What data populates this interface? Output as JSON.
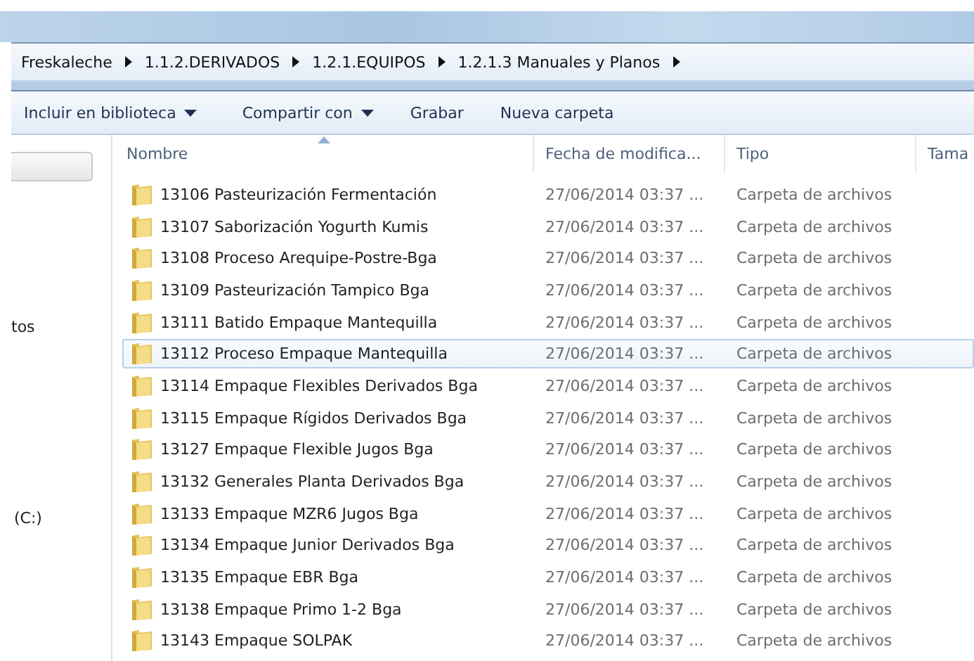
{
  "address_bar": {
    "crumbs": [
      "Freskaleche",
      "1.1.2.DERIVADOS",
      "1.2.1.EQUIPOS",
      "1.2.1.3 Manuales y Planos"
    ]
  },
  "toolbar": {
    "buttons": [
      {
        "label": "Incluir en biblioteca",
        "kind": "dropdown"
      },
      {
        "label": "Compartir con",
        "kind": "dropdown"
      },
      {
        "label": "Grabar",
        "kind": "plain"
      },
      {
        "label": "Nueva carpeta",
        "kind": "plain"
      }
    ]
  },
  "navigation_pane": {
    "items": [
      "tos",
      "(C:)"
    ]
  },
  "table": {
    "columns": [
      {
        "label": "Nombre",
        "sorted": true
      },
      {
        "label": "Fecha de modifica...",
        "sorted": false
      },
      {
        "label": "Tipo",
        "sorted": false
      },
      {
        "label": "Tama",
        "sorted": false
      }
    ],
    "rows": [
      {
        "name": "13106 Pasteurización Fermentación",
        "date": "27/06/2014 03:37 ...",
        "type": "Carpeta de archivos",
        "selected": false
      },
      {
        "name": "13107 Saborización Yogurth Kumis",
        "date": "27/06/2014 03:37 ...",
        "type": "Carpeta de archivos",
        "selected": false
      },
      {
        "name": "13108 Proceso Arequipe-Postre-Bga",
        "date": "27/06/2014 03:37 ...",
        "type": "Carpeta de archivos",
        "selected": false
      },
      {
        "name": "13109 Pasteurización Tampico Bga",
        "date": "27/06/2014 03:37 ...",
        "type": "Carpeta de archivos",
        "selected": false
      },
      {
        "name": "13111 Batido Empaque Mantequilla",
        "date": "27/06/2014 03:37 ...",
        "type": "Carpeta de archivos",
        "selected": false
      },
      {
        "name": "13112 Proceso Empaque Mantequilla",
        "date": "27/06/2014 03:37 ...",
        "type": "Carpeta de archivos",
        "selected": true
      },
      {
        "name": "13114 Empaque Flexibles Derivados Bga",
        "date": "27/06/2014 03:37 ...",
        "type": "Carpeta de archivos",
        "selected": false
      },
      {
        "name": "13115 Empaque Rígidos Derivados Bga",
        "date": "27/06/2014 03:37 ...",
        "type": "Carpeta de archivos",
        "selected": false
      },
      {
        "name": "13127 Empaque Flexible Jugos Bga",
        "date": "27/06/2014 03:37 ...",
        "type": "Carpeta de archivos",
        "selected": false
      },
      {
        "name": "13132 Generales Planta Derivados Bga",
        "date": "27/06/2014 03:37 ...",
        "type": "Carpeta de archivos",
        "selected": false
      },
      {
        "name": "13133 Empaque MZR6 Jugos Bga",
        "date": "27/06/2014 03:37 ...",
        "type": "Carpeta de archivos",
        "selected": false
      },
      {
        "name": "13134 Empaque Junior Derivados Bga",
        "date": "27/06/2014 03:37 ...",
        "type": "Carpeta de archivos",
        "selected": false
      },
      {
        "name": "13135 Empaque EBR Bga",
        "date": "27/06/2014 03:37 ...",
        "type": "Carpeta de archivos",
        "selected": false
      },
      {
        "name": "13138 Empaque Primo 1-2 Bga",
        "date": "27/06/2014 03:37 ...",
        "type": "Carpeta de archivos",
        "selected": false
      },
      {
        "name": "13143 Empaque SOLPAK",
        "date": "27/06/2014 03:37 ...",
        "type": "Carpeta de archivos",
        "selected": false
      }
    ]
  }
}
